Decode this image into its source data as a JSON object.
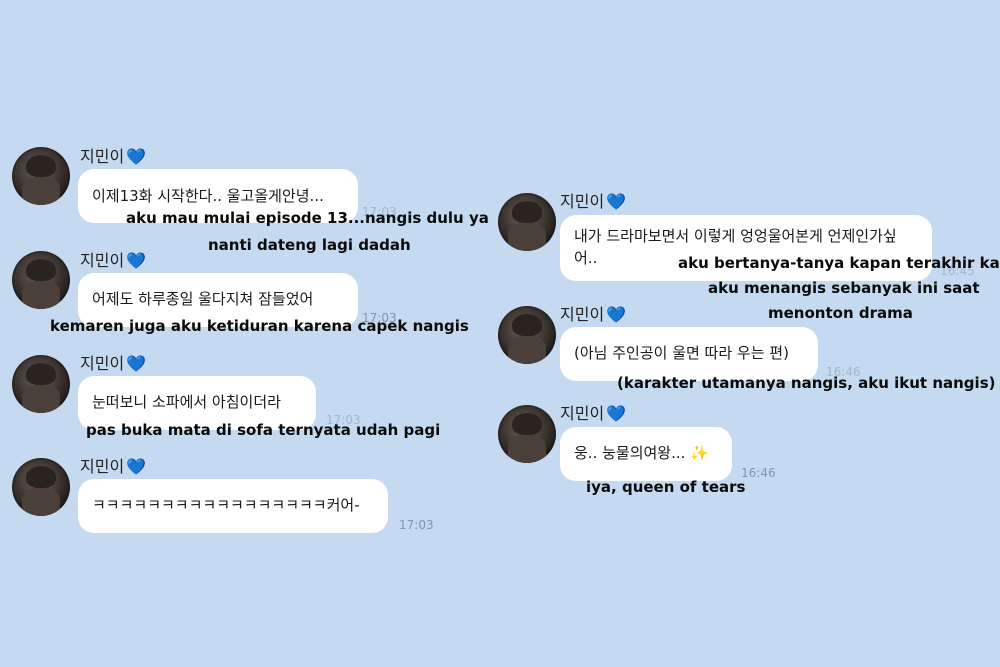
{
  "sender_name": "지민이",
  "heart_icon": "💙",
  "left_messages": [
    {
      "text": "이제13화 시작한다.. 울고올게안녕...",
      "time": "17:03",
      "translation": [
        "aku mau mulai episode 13...nangis dulu ya",
        "nanti dateng lagi dadah"
      ]
    },
    {
      "text": "어제도 하루종일 울다지쳐 잠들었어",
      "time": "17:03",
      "translation": [
        "kemaren juga aku ketiduran karena capek nangis"
      ]
    },
    {
      "text": "눈떠보니 소파에서 아침이더라",
      "time": "17:03",
      "translation": [
        "pas buka mata di sofa ternyata udah pagi"
      ]
    },
    {
      "text": "ㅋㅋㅋㅋㅋㅋㅋㅋㅋㅋㅋㅋㅋㅋㅋㅋㅋ커어-",
      "time": "17:03",
      "translation": []
    }
  ],
  "right_messages": [
    {
      "text": [
        "내가 드라마보면서 이렇게 엉엉울어본게 언제인가싶",
        "어.."
      ],
      "time": "16:45",
      "translation": [
        "aku bertanya-tanya kapan terakhir kali",
        "aku menangis sebanyak ini saat",
        "menonton drama"
      ]
    },
    {
      "text": "(아님 주인공이 울면 따라 우는 편)",
      "time": "16:46",
      "translation": [
        "(karakter utamanya nangis, aku ikut nangis)"
      ]
    },
    {
      "text": "웅.. 눙물의여왕... ✨",
      "time": "16:46",
      "translation": [
        "iya, queen of tears"
      ]
    }
  ]
}
